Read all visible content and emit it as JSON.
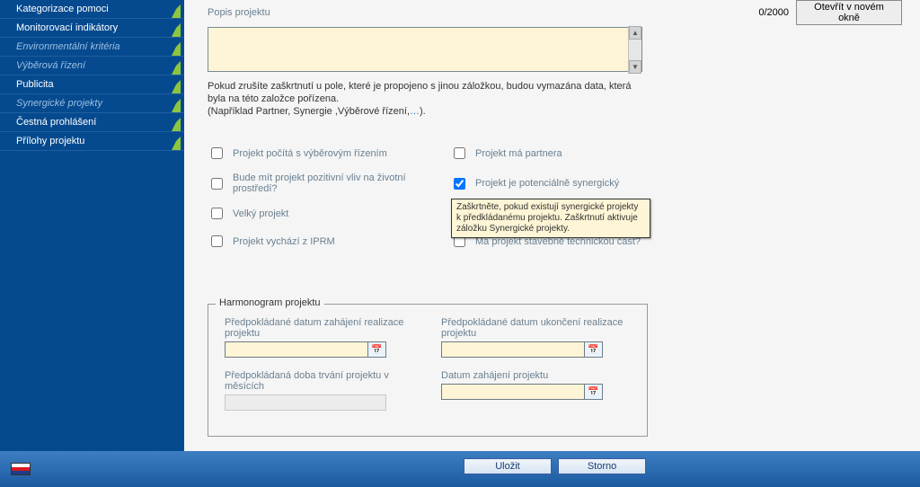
{
  "sidebar": {
    "items": [
      {
        "label": "Kategorizace pomoci",
        "dim": false
      },
      {
        "label": "Monitorovací indikátory",
        "dim": false
      },
      {
        "label": "Environmentální kritéria",
        "dim": true
      },
      {
        "label": "Výběrová řízení",
        "dim": true
      },
      {
        "label": "Publicita",
        "dim": false,
        "active": true
      },
      {
        "label": "Synergické projekty",
        "dim": true
      },
      {
        "label": "Čestná prohlášení",
        "dim": false
      },
      {
        "label": "Přílohy projektu",
        "dim": false
      }
    ]
  },
  "description": {
    "label": "Popis projektu",
    "counter": "0/2000",
    "open_btn": "Otevřít v novém okně"
  },
  "note": {
    "line1": "Pokud zrušíte zaškrtnutí u pole, které je propojeno s jinou záložkou, budou vymazána data, která byla na této založce pořízena.",
    "line2a": "(Například Partner, Synergie ,Výběrové řízení,",
    "line2b": "…",
    "line2c": ")."
  },
  "checkboxes": {
    "c1": "Projekt počítá s výběrovým řízením",
    "c2": "Projekt má partnera",
    "c3": "Bude mít projekt pozitivní vliv na životní prostředí?",
    "c4": "Projekt je potenciálně synergický",
    "c5": "Velký projekt",
    "c6": "",
    "c7": "Projekt vychází z IPRM",
    "c8": "Má projekt stavebně technickou část?"
  },
  "tooltip": "Zaškrtněte, pokud existují synergické projekty k předkládanému projektu. Zaškrtnutí aktivuje záložku Synergické projekty.",
  "fieldset": {
    "legend": "Harmonogram projektu",
    "f1": "Předpokládané datum zahájení realizace projektu",
    "f2": "Předpokládané datum ukončení realizace projektu",
    "f3": "Předpokládaná doba trvání projektu v měsících",
    "f4": "Datum zahájení projektu"
  },
  "buttons": {
    "save": "Uložit",
    "cancel": "Storno"
  }
}
